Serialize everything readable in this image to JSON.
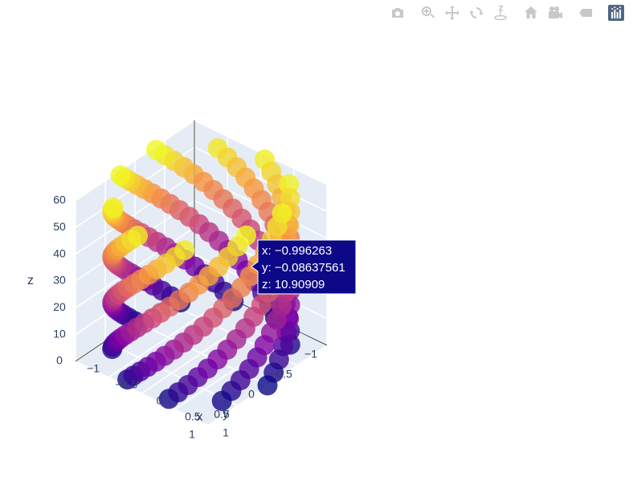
{
  "modebar": {
    "buttons": [
      {
        "name": "camera-icon",
        "group": 1
      },
      {
        "name": "zoom-icon",
        "group": 2
      },
      {
        "name": "pan-icon",
        "group": 2
      },
      {
        "name": "orbit-rotation-icon",
        "group": 2
      },
      {
        "name": "turntable-rotation-icon",
        "group": 2
      },
      {
        "name": "home-icon",
        "group": 3
      },
      {
        "name": "video-camera-icon",
        "group": 3
      },
      {
        "name": "spike-lines-icon",
        "group": 4
      },
      {
        "name": "plotly-logo-icon",
        "group": 5
      }
    ]
  },
  "chart_data": {
    "type": "scatter3d",
    "axes": {
      "x": {
        "title": "x",
        "range": [
          -1,
          1
        ],
        "ticks": [
          -1,
          -0.5,
          0,
          0.5,
          1
        ],
        "tick_labels": [
          "−1",
          "−0.5",
          "0",
          "0.5",
          "1"
        ]
      },
      "y": {
        "title": "y",
        "range": [
          -1,
          1
        ],
        "ticks": [
          -1,
          -0.5,
          0,
          0.5,
          1
        ],
        "tick_labels": [
          "−1",
          "−0.5",
          "0",
          "0.5",
          "1"
        ]
      },
      "z": {
        "title": "z",
        "range": [
          0,
          60
        ],
        "ticks": [
          0,
          10,
          20,
          30,
          40,
          50,
          60
        ],
        "tick_labels": [
          "0",
          "10",
          "20",
          "30",
          "40",
          "50",
          "60"
        ]
      }
    },
    "colorscale": "plasma",
    "marker_opacity": 0.8,
    "helices": [
      {
        "t_start": 0,
        "t_end": 60,
        "count": 100,
        "x": "cos(t)",
        "y": "sin(t)",
        "z": "t"
      },
      {
        "t_start": 0,
        "t_end": 60,
        "count": 100,
        "x": "-cos(t)",
        "y": "-sin(t)",
        "z": "t"
      }
    ],
    "hover": {
      "x_label": "x: −0.996263",
      "y_label": "y: −0.08637561",
      "z_label": "z: 10.90909",
      "point": {
        "x": -0.996263,
        "y": -0.08637561,
        "z": 10.90909
      },
      "bgcolor": "#0d0887"
    },
    "scene_bgcolor": "#e5ecf6",
    "grid": true
  }
}
